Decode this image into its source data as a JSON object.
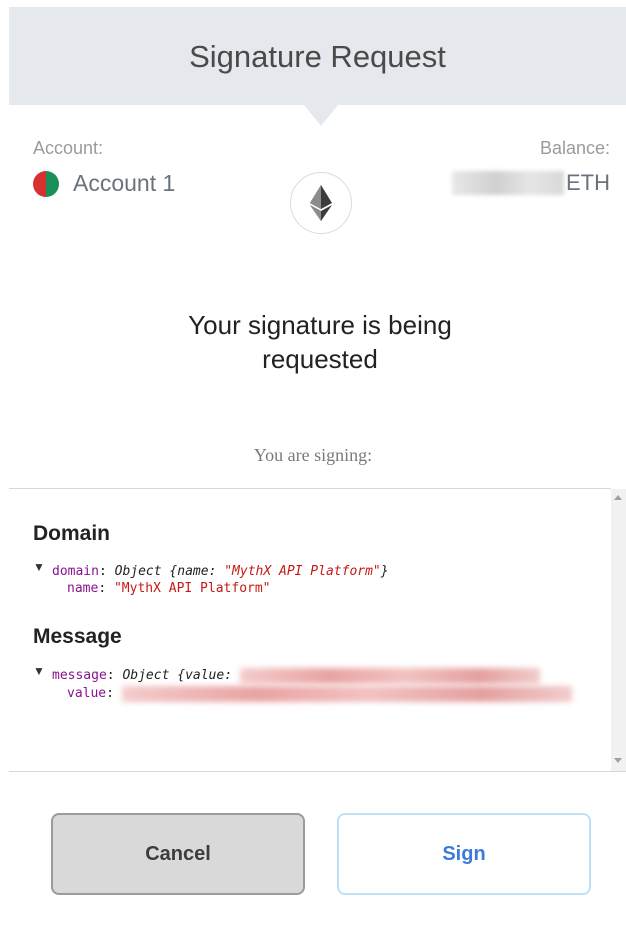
{
  "header": {
    "title": "Signature Request"
  },
  "account": {
    "label": "Account:",
    "name": "Account 1"
  },
  "balance": {
    "label": "Balance:",
    "currency": "ETH"
  },
  "request": {
    "title_line1": "Your signature is being",
    "title_line2": "requested",
    "signing_label": "You are signing:"
  },
  "domain_section": {
    "heading": "Domain",
    "key": "domain",
    "type": "Object",
    "prop": "name",
    "value": "\"MythX API Platform\""
  },
  "message_section": {
    "heading": "Message",
    "key": "message",
    "type": "Object",
    "prop": "value"
  },
  "buttons": {
    "cancel": "Cancel",
    "sign": "Sign"
  },
  "colors": {
    "header_bg": "#e5e8ec",
    "sign_text": "#3c7bd8",
    "cancel_bg": "#d9d9d9"
  }
}
